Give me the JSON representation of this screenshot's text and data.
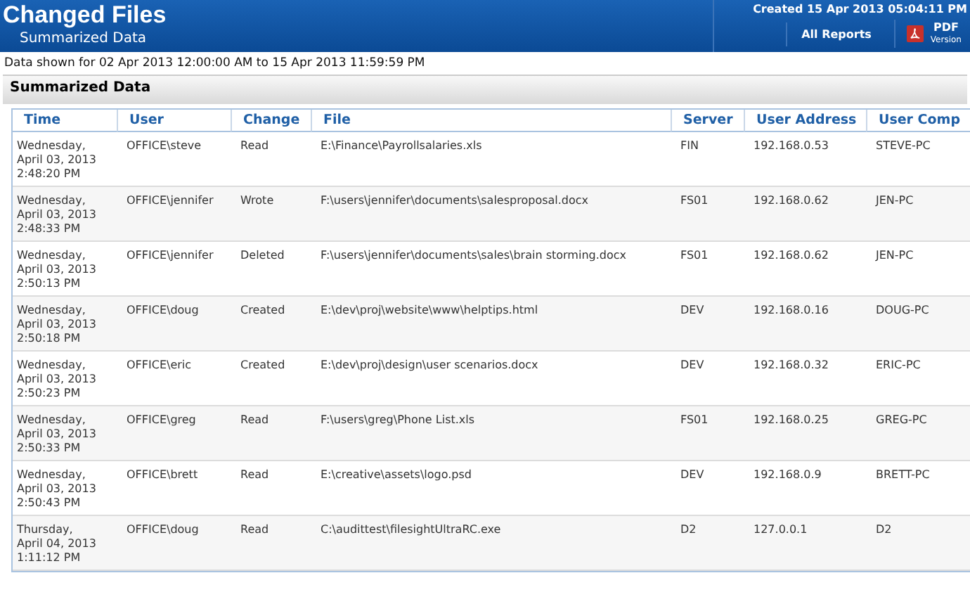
{
  "header": {
    "title": "Changed Files",
    "subtitle": "Summarized Data",
    "created": "Created 15 Apr 2013 05:04:11 PM",
    "buttons": [
      {
        "kind": "text",
        "label": "All Reports"
      },
      {
        "kind": "pdf",
        "label": "PDF",
        "sublabel": "Version"
      }
    ]
  },
  "range": "Data shown for 02 Apr 2013 12:00:00 AM to 15 Apr 2013 11:59:59 PM",
  "section": {
    "title": "Summarized Data"
  },
  "table": {
    "columns": [
      "Time",
      "User",
      "Change",
      "File",
      "Server",
      "User Address",
      "User Comp"
    ],
    "rows": [
      [
        "Wednesday,\nApril 03, 2013\n2:48:20 PM",
        "OFFICE\\steve",
        "Read",
        "E:\\Finance\\Payrollsalaries.xls",
        "FIN",
        "192.168.0.53",
        "STEVE-PC"
      ],
      [
        "Wednesday,\nApril 03, 2013\n2:48:33 PM",
        "OFFICE\\jennifer",
        "Wrote",
        "F:\\users\\jennifer\\documents\\salesproposal.docx",
        "FS01",
        "192.168.0.62",
        "JEN-PC"
      ],
      [
        "Wednesday,\nApril 03, 2013\n2:50:13 PM",
        "OFFICE\\jennifer",
        "Deleted",
        "F:\\users\\jennifer\\documents\\sales\\brain storming.docx",
        "FS01",
        "192.168.0.62",
        "JEN-PC"
      ],
      [
        "Wednesday,\nApril 03, 2013\n2:50:18 PM",
        "OFFICE\\doug",
        "Created",
        "E:\\dev\\proj\\website\\www\\helptips.html",
        "DEV",
        "192.168.0.16",
        "DOUG-PC"
      ],
      [
        "Wednesday,\nApril 03, 2013\n2:50:23 PM",
        "OFFICE\\eric",
        "Created",
        "E:\\dev\\proj\\design\\user scenarios.docx",
        "DEV",
        "192.168.0.32",
        "ERIC-PC"
      ],
      [
        "Wednesday,\nApril 03, 2013\n2:50:33 PM",
        "OFFICE\\greg",
        "Read",
        "F:\\users\\greg\\Phone List.xls",
        "FS01",
        "192.168.0.25",
        "GREG-PC"
      ],
      [
        "Wednesday,\nApril 03, 2013\n2:50:43 PM",
        "OFFICE\\brett",
        "Read",
        "E:\\creative\\assets\\logo.psd",
        "DEV",
        "192.168.0.9",
        "BRETT-PC"
      ],
      [
        "Thursday,\nApril 04, 2013\n1:11:12 PM",
        "OFFICE\\doug",
        "Read",
        "C:\\audittest\\filesightUltraRC.exe",
        "D2",
        "127.0.0.1",
        "D2"
      ]
    ]
  }
}
